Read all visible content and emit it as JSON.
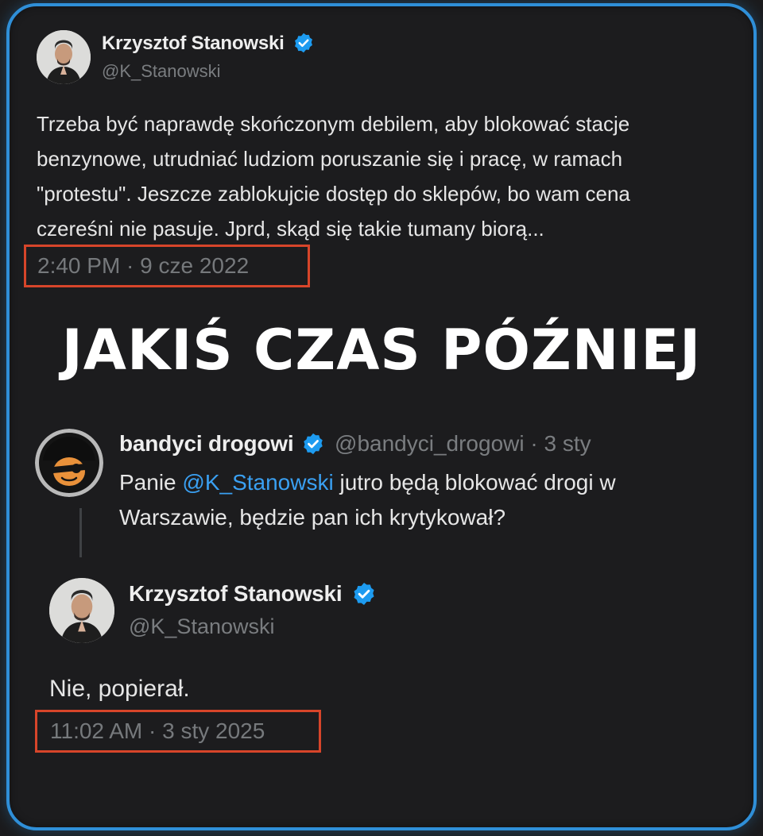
{
  "tweet1": {
    "author_name": "Krzysztof Stanowski",
    "author_handle": "@K_Stanowski",
    "text_lines": [
      "Trzeba być naprawdę skończonym debilem, aby blokować stacje",
      "benzynowe, utrudniać ludziom poruszanie się i pracę, w ramach",
      "\"protestu\". Jeszcze zablokujcie dostęp do sklepów, bo wam cena",
      "czereśni nie pasuje. Jprd, skąd się takie tumany biorą..."
    ],
    "timestamp": "2:40 PM · 9 cze 2022"
  },
  "banner": "JAKIŚ CZAS PÓŹNIEJ",
  "reply": {
    "author_name": "bandyci drogowi",
    "author_handle": "@bandyci_drogowi",
    "date": "· 3 sty",
    "text_prefix": "Panie ",
    "mention": "@K_Stanowski",
    "text_suffix": " jutro będą blokować drogi w",
    "text_line2": "Warszawie, będzie pan ich krytykował?"
  },
  "tweet2": {
    "author_name": "Krzysztof Stanowski",
    "author_handle": "@K_Stanowski",
    "text": "Nie, popierał.",
    "timestamp": "11:02 AM · 3 sty 2025"
  },
  "colors": {
    "frame_border": "#2f8fd8",
    "background": "#1c1c1e",
    "verified_badge": "#1d9bf0",
    "highlight_box": "#d7452a",
    "mention": "#3aa0f2"
  },
  "icons": {
    "verified": "verified-badge-icon",
    "avatar_person": "person-avatar-icon",
    "avatar_bandit": "masked-face-avatar-icon"
  }
}
